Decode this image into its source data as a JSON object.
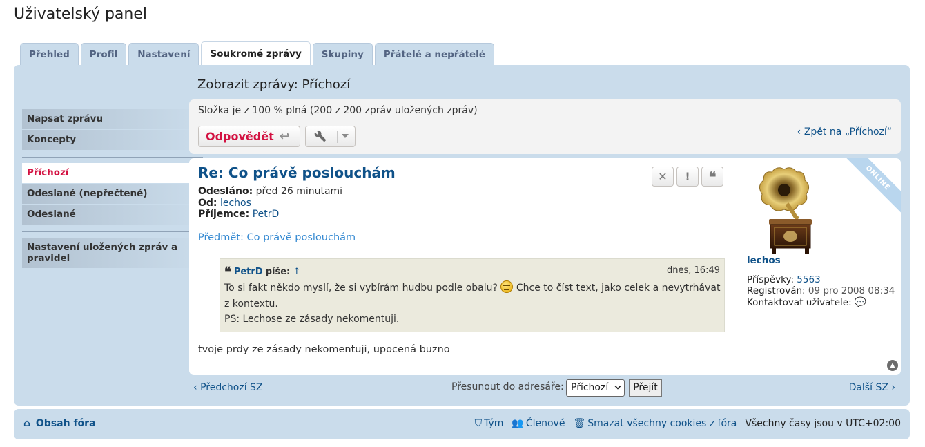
{
  "page": {
    "title": "Uživatelský panel"
  },
  "tabs": [
    {
      "label": "Přehled"
    },
    {
      "label": "Profil"
    },
    {
      "label": "Nastavení"
    },
    {
      "label": "Soukromé zprávy",
      "active": true
    },
    {
      "label": "Skupiny"
    },
    {
      "label": "Přátelé a nepřátelé"
    }
  ],
  "sidebar": {
    "group1": [
      {
        "label": "Napsat zprávu"
      },
      {
        "label": "Koncepty"
      }
    ],
    "group2": [
      {
        "label": "Příchozí",
        "active": true
      },
      {
        "label": "Odeslané (nepřečtené)"
      },
      {
        "label": "Odeslané"
      }
    ],
    "group3": [
      {
        "label": "Nastavení uložených zpráv a pravidel"
      }
    ]
  },
  "view": {
    "heading": "Zobrazit zprávy: Příchozí"
  },
  "folder": {
    "status": "Složka je z 100 % plná (200 z 200 zpráv uložených zpráv)",
    "reply_label": "Odpovědět",
    "back_label": "Zpět na „Příchozí“"
  },
  "message": {
    "title": "Re: Co právě poslouchám",
    "sent_label": "Odesláno:",
    "sent_value": "před 26 minutami",
    "from_label": "Od:",
    "from_value": "lechos",
    "to_label": "Příjemce:",
    "to_value": "PetrD",
    "subject_link": "Předmět: Co právě poslouchám",
    "quote": {
      "author": "PetrD",
      "writes": "píše:",
      "up": "↑",
      "time": "dnes, 16:49",
      "line1a": "To si fakt někdo myslí, že si vybírám hudbu podle obalu?",
      "line1b": "Chce to číst text, jako celek a nevytrhávat z kontextu.",
      "line2": "PS: Lechose ze zásady nekomentuji."
    },
    "body": "tvoje prdy ze zásady nekomentuji, upocená buzno",
    "actions": [
      {
        "icon": "close-icon"
      },
      {
        "icon": "report-icon"
      },
      {
        "icon": "quote-icon"
      }
    ]
  },
  "profile": {
    "online_badge": "ONLINE",
    "username": "lechos",
    "posts_label": "Příspěvky:",
    "posts_value": "5563",
    "registered_label": "Registrován:",
    "registered_value": "09 pro 2008 08:34",
    "contact_label": "Kontaktovat uživatele:"
  },
  "nav": {
    "prev": "Předchozí SZ",
    "next": "Další SZ",
    "move_label": "Přesunout do adresáře:",
    "folder_selected": "Příchozí",
    "go_label": "Přejít"
  },
  "footer": {
    "board_index": "Obsah fóra",
    "team": "Tým",
    "members": "Členové",
    "delete_cookies": "Smazat všechny cookies z fóra",
    "timezone": "Všechny časy jsou v UTC+02:00"
  },
  "colors": {
    "link": "#105289",
    "accent": "#d31141",
    "panel": "#cadceb"
  }
}
